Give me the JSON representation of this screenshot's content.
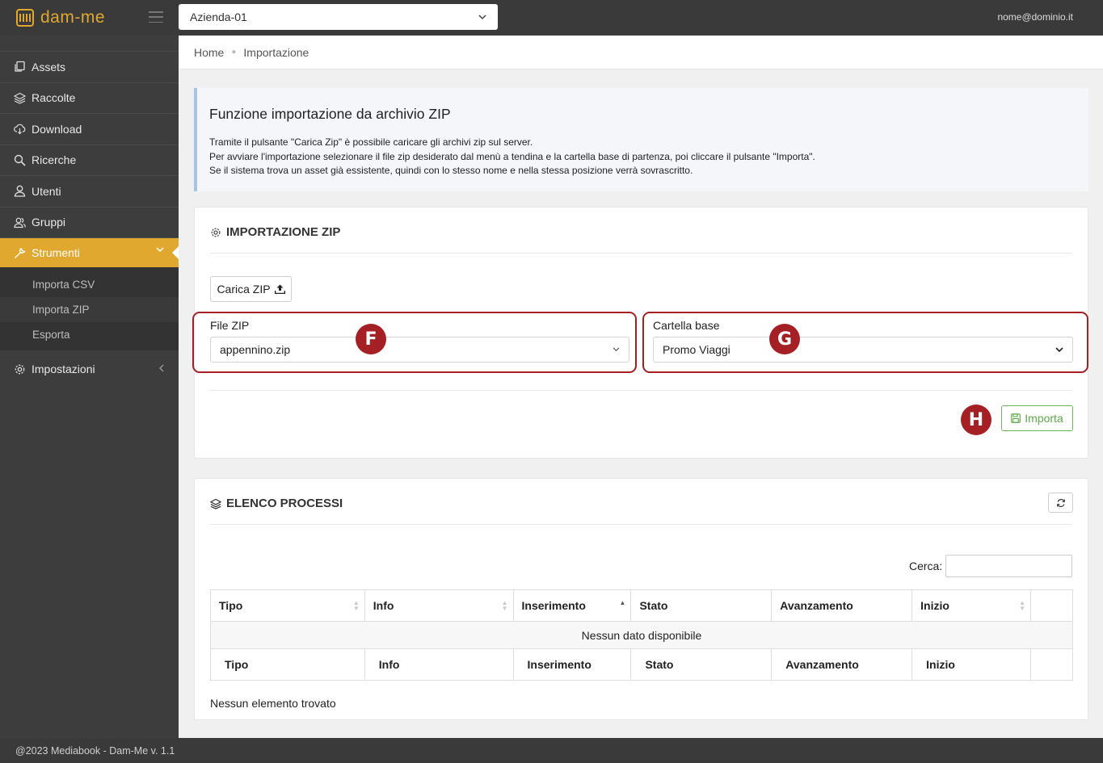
{
  "header": {
    "brand": "dam-me",
    "company_select": "Azienda-01",
    "user_email": "nome@dominio.it"
  },
  "sidebar": {
    "items": [
      {
        "label": "Assets",
        "icon": "copy-icon"
      },
      {
        "label": "Raccolte",
        "icon": "layers-icon"
      },
      {
        "label": "Download",
        "icon": "cloud-download-icon"
      },
      {
        "label": "Ricerche",
        "icon": "search-icon"
      },
      {
        "label": "Utenti",
        "icon": "user-icon"
      },
      {
        "label": "Gruppi",
        "icon": "users-icon"
      },
      {
        "label": "Strumenti",
        "icon": "wrench-icon"
      }
    ],
    "submenu": [
      "Importa CSV",
      "Importa ZIP",
      "Esporta"
    ],
    "settings_label": "Impostazioni",
    "accent_color": "#e0a82e"
  },
  "breadcrumb": {
    "home": "Home",
    "current": "Importazione"
  },
  "callout": {
    "title": "Funzione importazione da archivio ZIP",
    "lines": [
      "Tramite il pulsante \"Carica Zip\" è possibile caricare gli archivi zip sul server.",
      "Per avviare l'importazione selezionare il file zip desiderato dal menù a tendina e la cartella base di partenza, poi cliccare il pulsante \"Importa\".",
      "Se il sistema trova un asset già essistente, quindi con lo stesso nome e nella stessa posizione verrà sovrascritto."
    ]
  },
  "import_card": {
    "title": "IMPORTAZIONE ZIP",
    "upload_button": "Carica ZIP",
    "file_label": "File ZIP",
    "file_value": "appennino.zip",
    "folder_label": "Cartella base",
    "folder_value": "Promo Viaggi",
    "import_button": "Importa",
    "badges": [
      "F",
      "G",
      "H"
    ],
    "annotation_color": "#a42025"
  },
  "process_card": {
    "title": "ELENCO PROCESSI",
    "search_label": "Cerca:",
    "columns": [
      "Tipo",
      "Info",
      "Inserimento",
      "Stato",
      "Avanzamento",
      "Inizio"
    ],
    "empty_message": "Nessun dato disponibile",
    "no_items": "Nessun elemento trovato"
  },
  "footer": {
    "text": "@2023 Mediabook - Dam-Me v. 1.1"
  }
}
